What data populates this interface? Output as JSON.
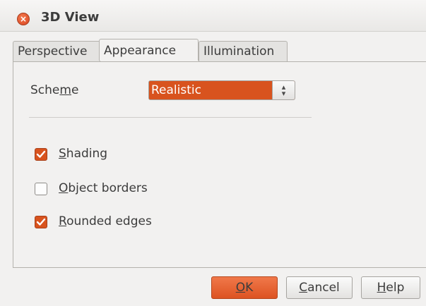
{
  "window": {
    "title": "3D View"
  },
  "tabs": [
    {
      "label": "Perspective"
    },
    {
      "label": "Appearance"
    },
    {
      "label": "Illumination"
    }
  ],
  "scheme": {
    "label_pre": "Sche",
    "label_mn": "m",
    "label_post": "e",
    "value": "Realistic"
  },
  "options": {
    "shading": {
      "mn": "S",
      "rest": "hading",
      "checked": true
    },
    "object_borders": {
      "mn": "O",
      "rest": "bject borders",
      "checked": false
    },
    "rounded_edges": {
      "mn": "R",
      "rest": "ounded edges",
      "checked": true
    }
  },
  "buttons": {
    "ok": {
      "mn": "O",
      "rest": "K"
    },
    "cancel": {
      "mn": "C",
      "rest": "ancel"
    },
    "help": {
      "mn": "H",
      "rest": "elp"
    }
  },
  "colors": {
    "accent": "#d8531e"
  },
  "icons": {
    "close": "close-icon",
    "check": "checkmark-icon",
    "spin": "spinner-arrows-icon"
  }
}
